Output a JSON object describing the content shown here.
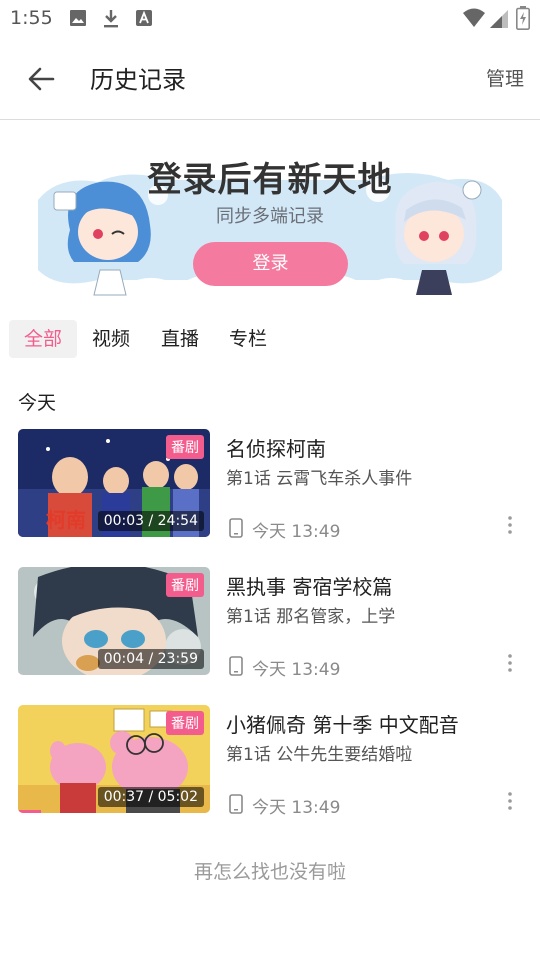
{
  "status_bar": {
    "time": "1:55",
    "icons": [
      "image-icon",
      "download-icon",
      "a-icon",
      "wifi-icon",
      "cellular-icon",
      "battery-icon"
    ]
  },
  "header": {
    "title": "历史记录",
    "manage": "管理"
  },
  "banner": {
    "title": "登录后有新天地",
    "subtitle": "同步多端记录",
    "login": "登录"
  },
  "tabs": [
    {
      "label": "全部",
      "active": true
    },
    {
      "label": "视频",
      "active": false
    },
    {
      "label": "直播",
      "active": false
    },
    {
      "label": "专栏",
      "active": false
    }
  ],
  "section": "今天",
  "items": [
    {
      "title": "名侦探柯南",
      "subtitle": "第1话 云霄飞车杀人事件",
      "badge": "番剧",
      "duration": "00:03 / 24:54",
      "time": "今天 13:49",
      "progress": 0.002
    },
    {
      "title": "黑执事 寄宿学校篇",
      "subtitle": "第1话 那名管家，上学",
      "badge": "番剧",
      "duration": "00:04 / 23:59",
      "time": "今天 13:49",
      "progress": 0.003
    },
    {
      "title": "小猪佩奇 第十季 中文配音",
      "subtitle": "第1话 公牛先生要结婚啦",
      "badge": "番剧",
      "duration": "00:37 / 05:02",
      "time": "今天 13:49",
      "progress": 0.122
    }
  ],
  "end_text": "再怎么找也没有啦",
  "colors": {
    "accent": "#f25d8e",
    "login_button": "#f47aa0"
  }
}
